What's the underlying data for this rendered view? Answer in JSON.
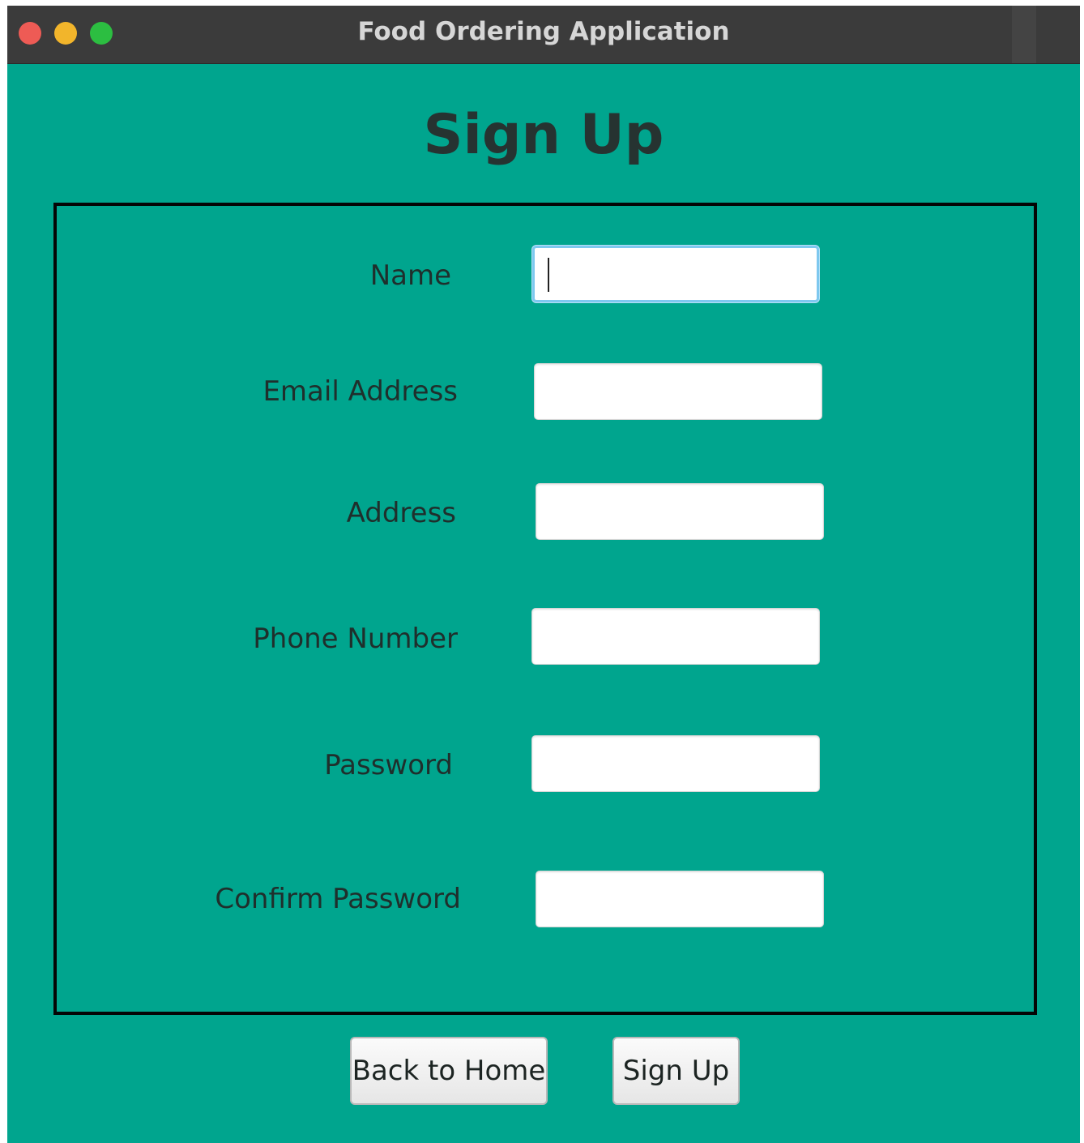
{
  "window": {
    "title": "Food Ordering Application"
  },
  "page": {
    "title": "Sign Up"
  },
  "form": {
    "fields": [
      {
        "label": "Name",
        "value": ""
      },
      {
        "label": "Email Address",
        "value": ""
      },
      {
        "label": "Address",
        "value": ""
      },
      {
        "label": "Phone Number",
        "value": ""
      },
      {
        "label": "Password",
        "value": ""
      },
      {
        "label": "Confirm Password",
        "value": ""
      }
    ]
  },
  "buttons": {
    "back_label": "Back to Home",
    "signup_label": "Sign Up"
  },
  "colors": {
    "background": "#00a58e",
    "titlebar": "#3b3b3b",
    "close": "#ee5b55",
    "minimize": "#f2b52b",
    "maximize": "#2cbe41"
  }
}
